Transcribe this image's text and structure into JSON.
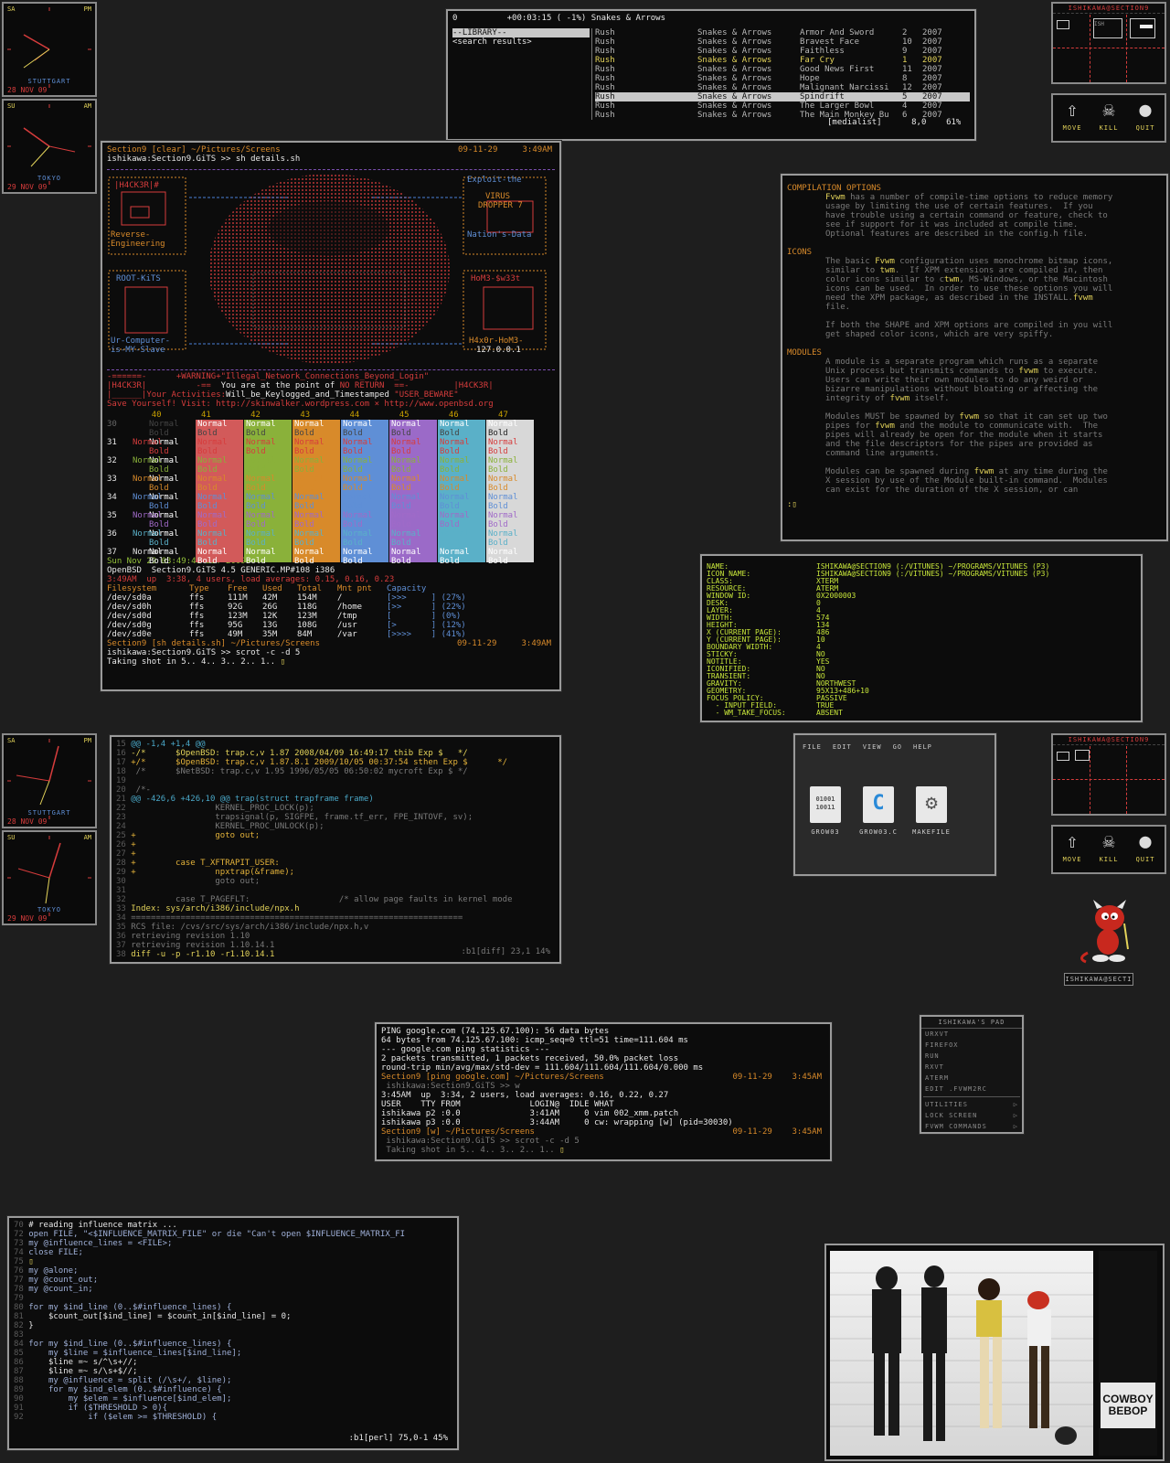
{
  "clocks": [
    {
      "day": "SA",
      "ampm": "PM",
      "city": "STUTTGART",
      "date": "28 NOV 09"
    },
    {
      "day": "SU",
      "ampm": "AM",
      "city": "TOKYO",
      "date": "29 NOV 09"
    },
    {
      "day": "SA",
      "ampm": "PM",
      "city": "STUTTGART",
      "date": "28 NOV 09"
    },
    {
      "day": "SU",
      "ampm": "AM",
      "city": "TOKYO",
      "date": "29 NOV 09"
    }
  ],
  "pager": {
    "title": "ISHIKAWA@SECTION9",
    "ish": "ISH"
  },
  "buttons": {
    "move": "MOVE",
    "kill": "KILL",
    "quit": "QUIT"
  },
  "mpd": {
    "status": {
      "num": "0",
      "time": "+00:03:15 ( -1%)",
      "title": "Snakes & Arrows"
    },
    "left": [
      "--LIBRARY--",
      "<search results>"
    ],
    "rows": [
      [
        "Rush",
        "Snakes & Arrows",
        "Armor And Sword",
        "2",
        "2007"
      ],
      [
        "Rush",
        "Snakes & Arrows",
        "Bravest Face",
        "10",
        "2007"
      ],
      [
        "Rush",
        "Snakes & Arrows",
        "Faithless",
        "9",
        "2007"
      ],
      [
        "Rush",
        "Snakes & Arrows",
        "Far Cry",
        "1",
        "2007"
      ],
      [
        "Rush",
        "Snakes & Arrows",
        "Good News First",
        "11",
        "2007"
      ],
      [
        "Rush",
        "Snakes & Arrows",
        "Hope",
        "8",
        "2007"
      ],
      [
        "Rush",
        "Snakes & Arrows",
        "Malignant Narcissi",
        "12",
        "2007"
      ],
      [
        "Rush",
        "Snakes & Arrows",
        "Spindrift",
        "5",
        "2007"
      ],
      [
        "Rush",
        "Snakes & Arrows",
        "The Larger Bowl",
        "4",
        "2007"
      ],
      [
        "Rush",
        "Snakes & Arrows",
        "The Main Monkey Bu",
        "6",
        "2007"
      ]
    ],
    "footer": {
      "name": "[medialist]",
      "pos": "8,0",
      "pct": "61%"
    }
  },
  "term1": {
    "header_left": "Section9 [clear] ~/Pictures/Screens",
    "header_date": "09-11-29",
    "header_time": "3:49AM",
    "prompt": "ishikawa:Section9.GiTS >> sh details.sh",
    "left_boxes": [
      "|H4CK3R|#",
      "Reverse-",
      "Engineering",
      "ROOT-KiTS",
      "Ur-Computer-",
      "is-MY-Slave"
    ],
    "right_boxes": [
      "Exploit-the",
      "VIRUS",
      "DROPPER 7",
      "Nation's-Data",
      "HoM3-$w33t",
      "H4x0r-HoM3-",
      "127.0.0.1"
    ],
    "warn1": "+WARNING+\"Illegal_Network_Connections_Beyond_Login\"",
    "warn2a": "|H4CK3R|",
    "warn2b": "You are at the point of",
    "warn2c": "NO RETURN",
    "warn2d": "|H4CK3R|",
    "warn3a": "|______|Your Activities:",
    "warn3b": "Will_be_Keylogged_and_Timestamped",
    "warn3c": "\"USER_BEWARE\"",
    "warn4": "Save Yourself! Visit: http://skinwalker.wordpress.com × http://www.openbsd.org",
    "col_numbers": [
      "40",
      "41",
      "42",
      "43",
      "44",
      "45",
      "46",
      "47"
    ],
    "row_numbers": [
      "30",
      "31",
      "32",
      "33",
      "34",
      "35",
      "36",
      "37"
    ],
    "normal": "Normal",
    "bold": "Bold",
    "date_line": "Sun Nov 29 03:49:41 JST 2009",
    "uname": "OpenBSD  Section9.GiTS 4.5 GENERIC.MP#108 i386",
    "uptime": "3:49AM  up  3:38, 4 users, load averages: 0.15, 0.16, 0.23",
    "df_header": [
      "Filesystem",
      "Type",
      "Free",
      "Used",
      "Total",
      "Mnt pnt",
      "Capacity"
    ],
    "df_rows": [
      [
        "/dev/sd0a",
        "ffs",
        "111M",
        "42M",
        "154M",
        "/",
        "[>>>     ] (27%)"
      ],
      [
        "/dev/sd0h",
        "ffs",
        "92G",
        "26G",
        "118G",
        "/home",
        "[>>      ] (22%)"
      ],
      [
        "/dev/sd0d",
        "ffs",
        "123M",
        "12K",
        "123M",
        "/tmp",
        "[        ] (0%)"
      ],
      [
        "/dev/sd0g",
        "ffs",
        "95G",
        "13G",
        "108G",
        "/usr",
        "[>       ] (12%)"
      ],
      [
        "/dev/sd0e",
        "ffs",
        "49M",
        "35M",
        "84M",
        "/var",
        "[>>>>    ] (41%)"
      ]
    ],
    "footer_left": "Section9 [sh details.sh] ~/Pictures/Screens",
    "footer_date": "09-11-29",
    "footer_time": "3:49AM",
    "prompt2": "ishikawa:Section9.GiTS >> scrot -c -d 5",
    "shot": "Taking shot in 5.. 4.. 3.. 2.. 1.. "
  },
  "fvwm_doc": {
    "h1": "COMPILATION OPTIONS",
    "p1": [
      "Fvwm has a number of compile-time options to reduce memory",
      "usage by limiting the use of certain features.  If you",
      "have trouble using a certain command or feature, check to",
      "see if support for it was included at compile time.",
      "Optional features are described in the config.h file."
    ],
    "h2": "ICONS",
    "p2": [
      "The basic Fvwm configuration uses monochrome bitmap icons,",
      "similar to twm.  If XPM extensions are compiled in, then",
      "color icons similar to ctwm, MS-Windows, or the Macintosh",
      "icons can be used.  In order to use these options you will",
      "need the XPM package, as described in the INSTALL.fvwm",
      "file.",
      "",
      "If both the SHAPE and XPM options are compiled in you will",
      "get shaped color icons, which are very spiffy."
    ],
    "h3": "MODULES",
    "p3": [
      "A module is a separate program which runs as a separate",
      "Unix process but transmits commands to fvwm to execute.",
      "Users can write their own modules to do any weird or",
      "bizarre manipulations without bloating or affecting the",
      "integrity of fvwm itself.",
      "",
      "Modules MUST be spawned by fvwm so that it can set up two",
      "pipes for fvwm and the module to communicate with.  The",
      "pipes will already be open for the module when it starts",
      "and the file descriptors for the pipes are provided as",
      "command line arguments.",
      "",
      "Modules can be spawned during fvwm at any time during the",
      "X session by use of the Module built-in command.  Modules",
      "can exist for the duration of the X session, or can"
    ],
    "prompt": ":"
  },
  "ident": {
    "rows": [
      [
        "NAME:",
        "ISHIKAWA@SECTION9 (:/VITUNES) ~/PROGRAMS/VITUNES (P3)"
      ],
      [
        "ICON NAME:",
        "ISHIKAWA@SECTION9 (:/VITUNES) ~/PROGRAMS/VITUNES (P3)"
      ],
      [
        "CLASS:",
        "XTERM"
      ],
      [
        "RESOURCE:",
        "ATERM"
      ],
      [
        "WINDOW ID:",
        "0X2000003"
      ],
      [
        "DESK:",
        "0"
      ],
      [
        "LAYER:",
        "4"
      ],
      [
        "WIDTH:",
        "574"
      ],
      [
        "HEIGHT:",
        "134"
      ],
      [
        "X (CURRENT PAGE):",
        "486"
      ],
      [
        "Y (CURRENT PAGE):",
        "10"
      ],
      [
        "BOUNDARY WIDTH:",
        "4"
      ],
      [
        "STICKY:",
        "NO"
      ],
      [
        "NOTITLE:",
        "YES"
      ],
      [
        "ICONIFIED:",
        "NO"
      ],
      [
        "TRANSIENT:",
        "NO"
      ],
      [
        "GRAVITY:",
        "NORTHWEST"
      ],
      [
        "GEOMETRY:",
        "95X13+486+10"
      ],
      [
        "FOCUS POLICY:",
        "PASSIVE"
      ],
      [
        "  - INPUT FIELD:",
        "TRUE"
      ],
      [
        "  - WM_TAKE_FOCUS:",
        "ABSENT"
      ]
    ]
  },
  "diff": {
    "lines": [
      [
        "15",
        "@@ -1,4 +1,4 @@"
      ],
      [
        "16",
        "-/*      $OpenBSD: trap.c,v 1.87 2008/04/09 16:49:17 thib Exp $   */"
      ],
      [
        "17",
        "+/*      $OpenBSD: trap.c,v 1.87.8.1 2009/10/05 00:37:54 sthen Exp $      */"
      ],
      [
        "18",
        " /*      $NetBSD: trap.c,v 1.95 1996/05/05 06:50:02 mycroft Exp $ */"
      ],
      [
        "19",
        " "
      ],
      [
        "20",
        " /*-"
      ],
      [
        "21",
        "@@ -426,6 +426,10 @@ trap(struct trapframe frame)"
      ],
      [
        "22",
        "                 KERNEL_PROC_LOCK(p);"
      ],
      [
        "23",
        "                 trapsignal(p, SIGFPE, frame.tf_err, FPE_INTOVF, sv);"
      ],
      [
        "24",
        "                 KERNEL_PROC_UNLOCK(p);"
      ],
      [
        "25",
        "+                goto out;"
      ],
      [
        "26",
        "+"
      ],
      [
        "27",
        "+"
      ],
      [
        "28",
        "+        case T_XFTRAPIT_USER:"
      ],
      [
        "29",
        "+                npxtrap(&frame);"
      ],
      [
        "30",
        "                 goto out;"
      ],
      [
        "31",
        " "
      ],
      [
        "32",
        "         case T_PAGEFLT:                  /* allow page faults in kernel mode"
      ],
      [
        "33",
        "Index: sys/arch/i386/include/npx.h"
      ],
      [
        "34",
        "==================================================================="
      ],
      [
        "35",
        "RCS file: /cvs/src/sys/arch/i386/include/npx.h,v"
      ],
      [
        "36",
        "retrieving revision 1.10"
      ],
      [
        "37",
        "retrieving revision 1.10.14.1"
      ],
      [
        "38",
        "diff -u -p -r1.10 -r1.10.14.1"
      ]
    ],
    "status": ":b1[diff] 23,1 14%"
  },
  "filemanager": {
    "menu": [
      "FILE",
      "EDIT",
      "VIEW",
      "GO",
      "HELP"
    ],
    "files": [
      {
        "name": "GROW03",
        "glyph": "01001 10011"
      },
      {
        "name": "GROW03.C",
        "glyph": "C"
      },
      {
        "name": "MAKEFILE",
        "glyph": "⚙"
      }
    ]
  },
  "daemon_label": "ISHIKAWA@SECTI",
  "ping": {
    "lines": [
      "PING google.com (74.125.67.100): 56 data bytes",
      "64 bytes from 74.125.67.100: icmp_seq=0 ttl=51 time=111.604 ms",
      "--- google.com ping statistics ---",
      "2 packets transmitted, 1 packets received, 50.0% packet loss",
      "round-trip min/avg/max/std-dev = 111.604/111.604/111.604/0.000 ms"
    ],
    "bar1": "Section9 [ping google.com] ~/Pictures/Screens",
    "bar1_date": "09-11-29",
    "bar1_time": "3:45AM",
    "prompt1": " ishikawa:Section9.GiTS >> w",
    "w1": "3:45AM  up  3:34, 2 users, load averages: 0.16, 0.22, 0.27",
    "w2": "USER    TTY FROM              LOGIN@  IDLE WHAT",
    "w3": "ishikawa p2 :0.0              3:41AM     0 vim 002_xmm.patch",
    "w4": "ishikawa p3 :0.0              3:44AM     0 cw: wrapping [w] (pid=30030)",
    "bar2": "Section9 [w] ~/Pictures/Screens",
    "bar2_date": "09-11-29",
    "bar2_time": "3:45AM",
    "prompt2": " ishikawa:Section9.GiTS >> scrot -c -d 5",
    "shot": " Taking shot in 5.. 4.. 3.. 2.. 1.. "
  },
  "menu": {
    "title": "ISHIKAWA'S PAD",
    "items": [
      "URXVT",
      "FIREFOX",
      "RUN",
      "RXVT",
      "ATERM",
      "EDIT .FVWM2RC"
    ],
    "sub": [
      "UTILITIES",
      "LOCK SCREEN",
      "FVWM COMMANDS"
    ]
  },
  "perl": {
    "lines": [
      [
        "",
        "# reading influence matrix ..."
      ],
      [
        "72",
        "open FILE, \"<$INFLUENCE_MATRIX_FILE\" or die \"Can't open $INFLUENCE_MATRIX_FI"
      ],
      [
        "73",
        "my @influence_lines = <FILE>;"
      ],
      [
        "74",
        "close FILE;"
      ],
      [
        "75",
        ""
      ],
      [
        "76",
        "my @alone;"
      ],
      [
        "77",
        "my @count_out;"
      ],
      [
        "78",
        "my @count_in;"
      ],
      [
        "79",
        ""
      ],
      [
        "80",
        "for my $ind_line (0..$#influence_lines) {"
      ],
      [
        "81",
        "    $count_out[$ind_line] = $count_in[$ind_line] = 0;"
      ],
      [
        "82",
        "}"
      ],
      [
        "83",
        ""
      ],
      [
        "84",
        "for my $ind_line (0..$#influence_lines) {"
      ],
      [
        "85",
        "    my $line = $influence_lines[$ind_line];"
      ],
      [
        "86",
        "    $line =~ s/^\\s+//;"
      ],
      [
        "87",
        "    $line =~ s/\\s+$//;"
      ],
      [
        "88",
        "    my @influence = split (/\\s+/, $line);"
      ],
      [
        "89",
        "    for my $ind_elem (0..$#influence) {"
      ],
      [
        "90",
        "        my $elem = $influence[$ind_elem];"
      ],
      [
        "91",
        "        if ($THRESHOLD > 0){"
      ],
      [
        "92",
        "            if ($elem >= $THRESHOLD) {"
      ]
    ],
    "status": ":b1[perl] 75,0-1 45%",
    "line70": "70"
  },
  "bebop": {
    "logo1": "COWBOY",
    "logo2": "BEBOP"
  },
  "colors": {
    "bg": "#1e1e1e",
    "accent": "#e3d35a",
    "alert": "#d63c3c",
    "ident": "#c7e53a"
  }
}
